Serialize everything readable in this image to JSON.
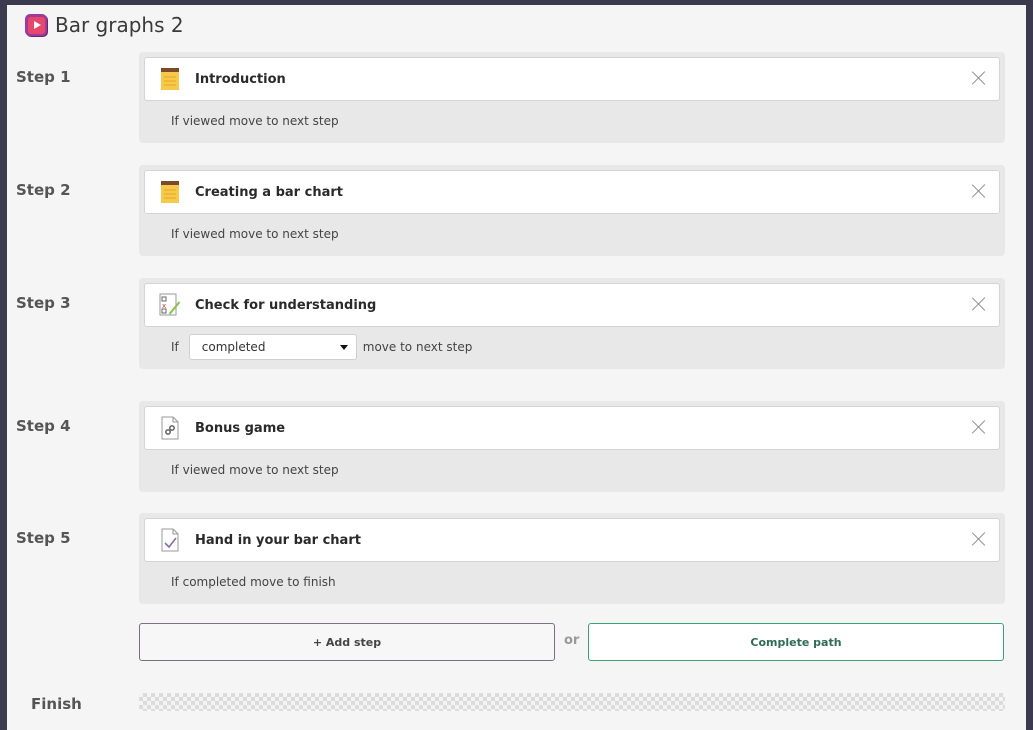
{
  "header": {
    "title": "Bar graphs 2",
    "icon": "play-icon"
  },
  "steps": [
    {
      "label": "Step 1",
      "title": "Introduction",
      "icon": "notepad-icon",
      "cond_prefix": "If",
      "cond_value": "viewed",
      "cond_suffix": "move to next step"
    },
    {
      "label": "Step 2",
      "title": "Creating a bar chart",
      "icon": "notepad-icon",
      "cond_prefix": "If",
      "cond_value": "viewed",
      "cond_suffix": "move to next step"
    },
    {
      "label": "Step 3",
      "title": "Check for understanding",
      "icon": "checklist-icon",
      "cond_prefix": "If",
      "cond_value": "completed",
      "cond_suffix": "move to next step"
    },
    {
      "label": "Step 4",
      "title": "Bonus game",
      "icon": "link-document-icon",
      "cond_prefix": "If",
      "cond_value": "viewed",
      "cond_suffix": "move to next step"
    },
    {
      "label": "Step 5",
      "title": "Hand in your bar chart",
      "icon": "checked-document-icon",
      "cond_prefix": "If",
      "cond_value": "completed",
      "cond_suffix": "move to finish"
    }
  ],
  "actions": {
    "add_step": "+ Add step",
    "or": "or",
    "complete_path": "Complete path"
  },
  "finish": {
    "label": "Finish"
  },
  "colors": {
    "background": "#3c3a4e",
    "panel": "#f5f5f5",
    "step_box": "#e8e8e8",
    "complete_border": "#3aa37a",
    "add_border": "#7d6e84",
    "accent": "#e8476b"
  }
}
